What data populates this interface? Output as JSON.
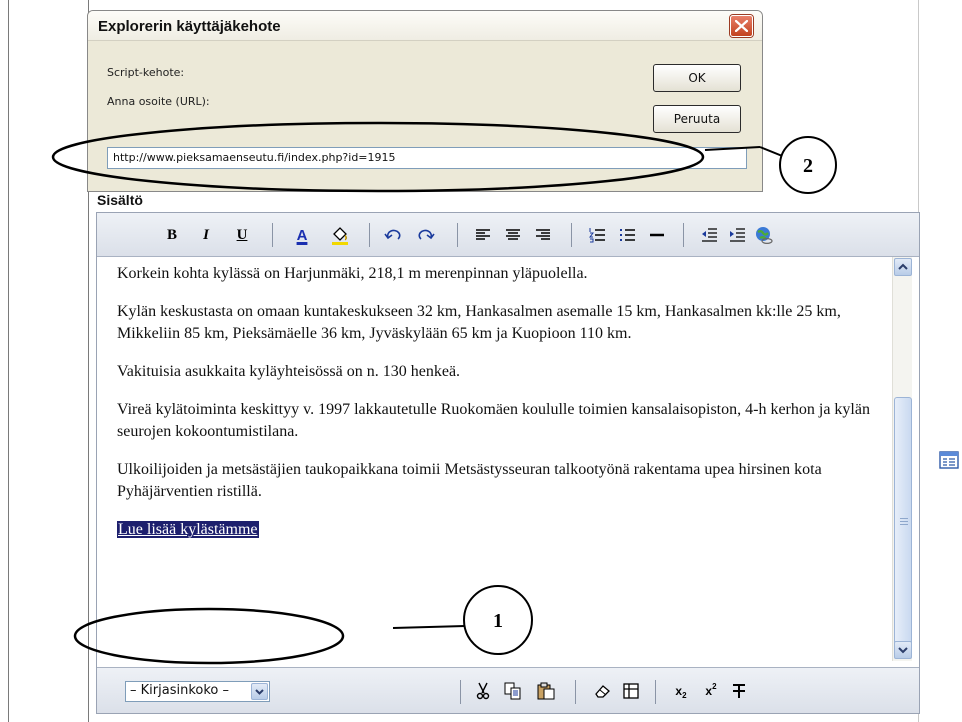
{
  "dialog": {
    "title": "Explorerin käyttäjäkehote",
    "script_label": "Script-kehote:",
    "url_label": "Anna osoite (URL):",
    "ok_label": "OK",
    "cancel_label": "Peruuta",
    "url_value": "http://www.pieksamaenseutu.fi/index.php?id=1915"
  },
  "section_label": "Sisältö",
  "toolbar": {
    "bold": "B",
    "italic": "I",
    "underline": "U",
    "font_color_glyph": "A"
  },
  "content": {
    "paragraphs": [
      "Korkein kohta kylässä on Harjunmäki, 218,1 m merenpinnan yläpuolella.",
      "Kylän keskustasta on omaan kuntakeskukseen 32 km, Hankasalmen asemalle 15 km, Hankasalmen kk:lle 25 km, Mikkeliin 85 km, Pieksämäelle 36 km, Jyväskylään 65 km ja Kuopioon 110 km.",
      "Vakituisia asukkaita kyläyhteisössä on n. 130 henkeä.",
      "Vireä kylätoiminta keskittyy v. 1997 lakkautetulle Ruokomäen koululle toimien kansalaisopiston, 4-h kerhon ja kylän seurojen kokoontumistilana.",
      "Ulkoilijoiden ja metsästäjien taukopaikkana toimii Metsästysseuran talkootyönä rakentama upea hirsinen kota Pyhäjärventien ristillä."
    ],
    "link_text": "Lue lisää kylästämme"
  },
  "bottombar": {
    "font_size_select": "– Kirjasinkoko –",
    "subscript_base": "x",
    "subscript_sub": "2",
    "superscript_base": "x",
    "superscript_sup": "2"
  },
  "annotations": {
    "callout_1": "1",
    "callout_2": "2"
  },
  "colors": {
    "selection": "#1d1f6d",
    "toolbar_bg": "#dbe0e9",
    "dialog_bg": "#ece9d8",
    "close_red": "#c2421f"
  }
}
